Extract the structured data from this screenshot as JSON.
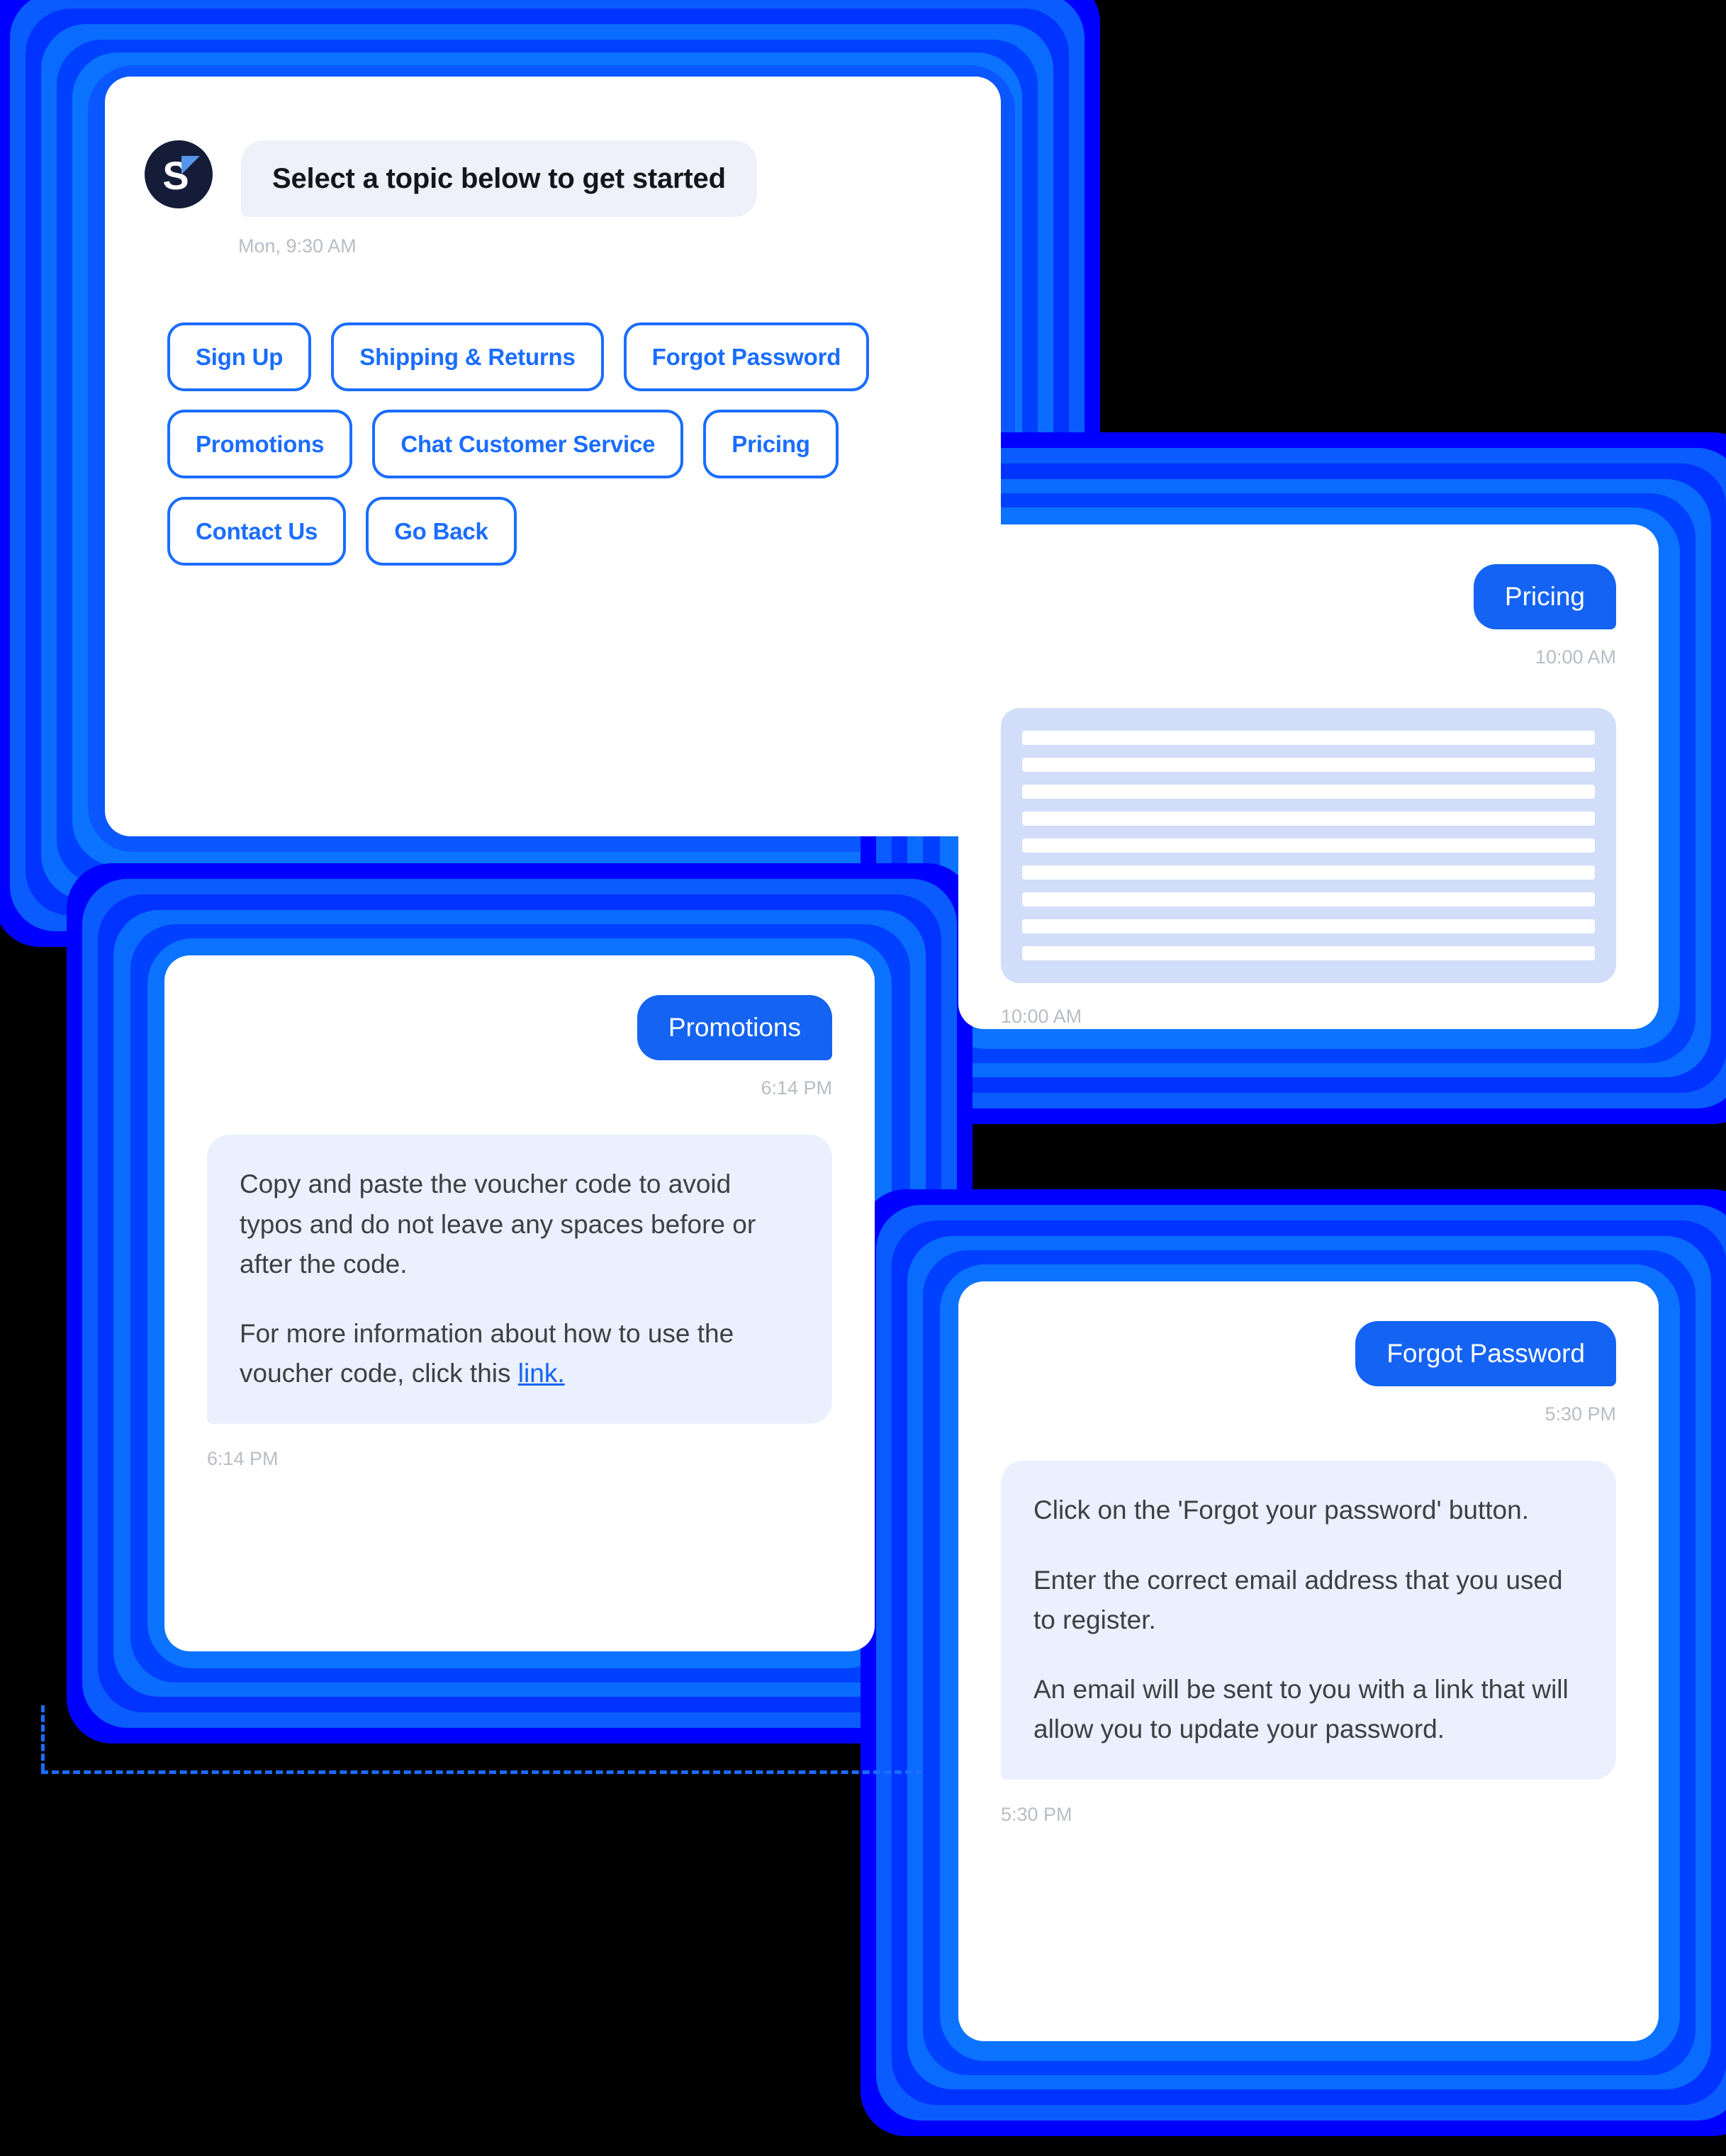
{
  "theme": {
    "background": "#000000",
    "accent_blue": "#1a6dff",
    "bubble_blue": "#1463f3",
    "bubble_grey": "#eaf0fd",
    "avatar_navy": "#141c38",
    "avatar_triangle": "#5596e8",
    "skeleton_fill": "#d2ddfa",
    "timestamp_grey": "#b9bcc4"
  },
  "menu_card": {
    "avatar": {
      "letter": "S",
      "icon": "brand-s-logo"
    },
    "intro_message": "Select a topic below to get started",
    "timestamp": "Mon, 9:30 AM",
    "topics": [
      {
        "label": "Sign Up"
      },
      {
        "label": "Shipping & Returns"
      },
      {
        "label": "Forgot Password"
      },
      {
        "label": "Promotions"
      },
      {
        "label": "Chat Customer Service"
      },
      {
        "label": "Pricing"
      },
      {
        "label": "Contact Us"
      },
      {
        "label": "Go Back"
      }
    ]
  },
  "pricing_card": {
    "user_message": "Pricing",
    "user_timestamp": "10:00 AM",
    "reply_state": "loading-skeleton",
    "skeleton_lines": 9,
    "reply_timestamp": "10:00 AM"
  },
  "promotions_card": {
    "user_message": "Promotions",
    "user_timestamp": "6:14 PM",
    "reply_paragraph_1": "Copy and paste the voucher code to avoid typos and do not leave any spaces before or after the code.",
    "reply_paragraph_2_before_link": "For more information about how to use the voucher code, click this ",
    "reply_link_text": "link.",
    "reply_timestamp": "6:14 PM"
  },
  "forgot_card": {
    "user_message": "Forgot Password",
    "user_timestamp": "5:30 PM",
    "reply_paragraph_1": "Click on the 'Forgot your password' button.",
    "reply_paragraph_2": "Enter the correct email address that you used to register.",
    "reply_paragraph_3": "An email will be sent to you with a link that will allow you to update your password.",
    "reply_timestamp": "5:30 PM"
  }
}
